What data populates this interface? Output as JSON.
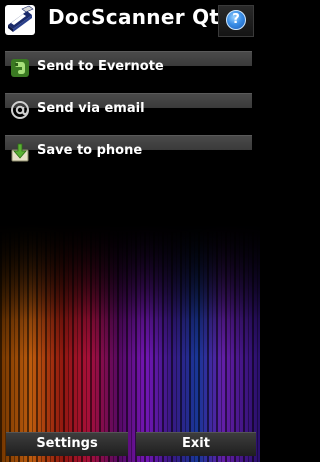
{
  "app": {
    "title": "DocScanner Qt",
    "icon": "scanner-icon",
    "help_icon": "help-icon",
    "help_symbol": "?"
  },
  "menu": {
    "items": [
      {
        "label": "Send to Evernote",
        "icon": "evernote-icon"
      },
      {
        "label": "Send via email",
        "icon": "at-sign-icon"
      },
      {
        "label": "Save to phone",
        "icon": "save-download-icon"
      }
    ]
  },
  "bottom": {
    "settings_label": "Settings",
    "exit_label": "Exit"
  },
  "colors": {
    "background": "#000000",
    "bar": "#3f3f3f",
    "help_blue": "#3a8ee6",
    "evernote_green": "#5bb134"
  }
}
